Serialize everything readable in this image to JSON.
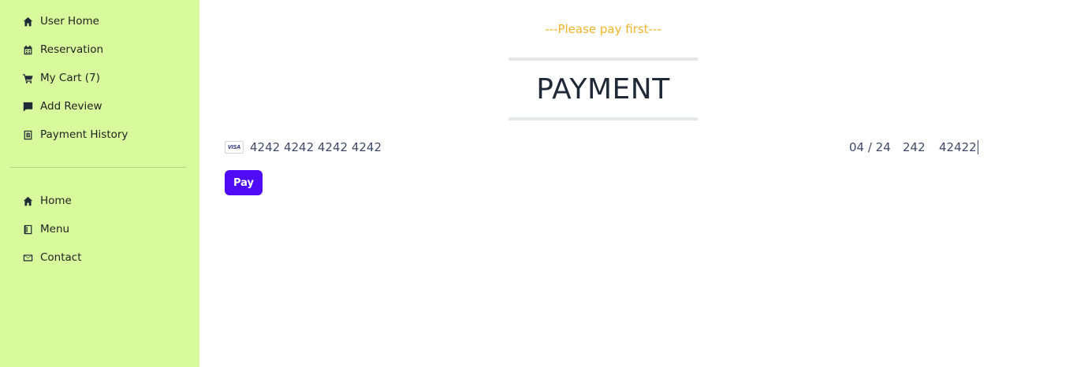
{
  "sidebar": {
    "primary_items": [
      {
        "label": "User Home",
        "icon": "home-icon"
      },
      {
        "label": "Reservation",
        "icon": "calendar-icon"
      },
      {
        "label": "My Cart (7)",
        "icon": "cart-icon"
      },
      {
        "label": "Add Review",
        "icon": "review-icon"
      },
      {
        "label": "Payment History",
        "icon": "payment-history-icon"
      }
    ],
    "secondary_items": [
      {
        "label": "Home",
        "icon": "home-icon"
      },
      {
        "label": "Menu",
        "icon": "book-icon"
      },
      {
        "label": "Contact",
        "icon": "mail-icon"
      }
    ],
    "background": "#d9fa9c"
  },
  "main": {
    "notice": "---Please pay first---",
    "title": "PAYMENT",
    "card": {
      "brand": "VISA",
      "number": "4242 4242 4242 4242",
      "expiry": "04 / 24",
      "cvc": "242",
      "zip": "42422"
    },
    "pay_label": "Pay"
  },
  "colors": {
    "notice": "#f0b429",
    "pay_button": "#4f0bf5"
  }
}
